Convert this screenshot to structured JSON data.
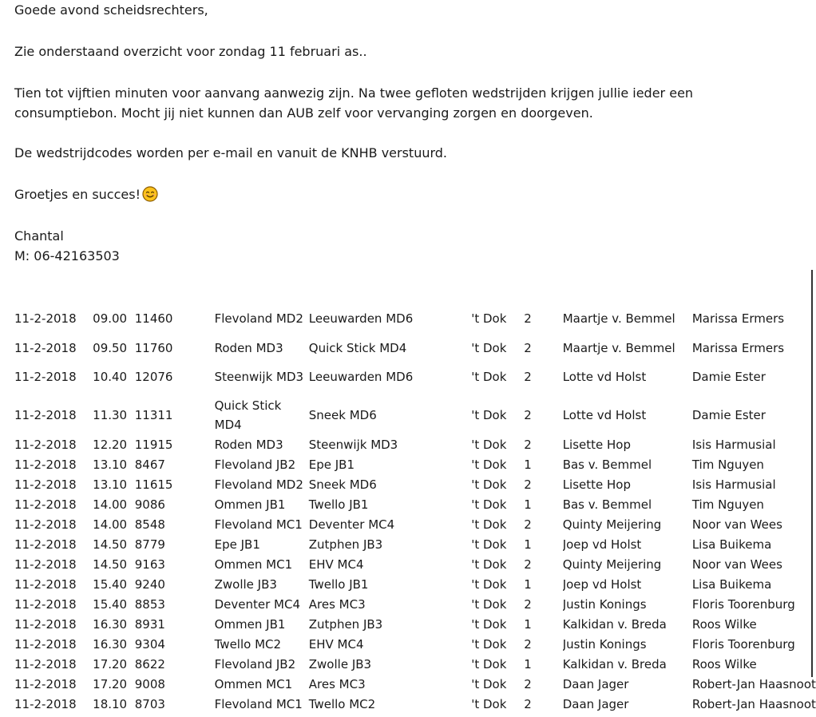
{
  "letter": {
    "greeting": "Goede avond scheidsrechters,",
    "intro": "Zie onderstaand overzicht voor zondag 11 februari as..",
    "instruction_1": "Tien tot vijftien minuten voor aanvang aanwezig zijn. Na twee gefloten wedstrijden krijgen jullie ieder een",
    "instruction_2": "consumptiebon. Mocht jij niet kunnen dan AUB zelf voor vervanging zorgen en doorgeven.",
    "codes_note": "De wedstrijdcodes worden per e-mail en vanuit de KNHB verstuurd.",
    "closing": "Groetjes en succes!",
    "closing_icon": "smiling-face-icon",
    "signature_name": "Chantal",
    "signature_phone": "M: 06-42163503"
  },
  "colors": {
    "text": "#1a1a1a",
    "emoji_face": "#fcc21b",
    "emoji_outline": "#8a5a00"
  },
  "schedule": [
    {
      "date": "11-2-2018",
      "time": "09.00",
      "code": "11460",
      "home": "Flevoland MD2",
      "away": "Leeuwarden MD6",
      "location": "'t Dok",
      "field": "2",
      "ref1": "Maartje v. Bemmel",
      "ref2": "Marissa Ermers"
    },
    {
      "date": "11-2-2018",
      "time": "09.50",
      "code": "11760",
      "home": "Roden MD3",
      "away": "Quick Stick MD4",
      "location": "'t Dok",
      "field": "2",
      "ref1": "Maartje v. Bemmel",
      "ref2": "Marissa Ermers"
    },
    {
      "date": "11-2-2018",
      "time": "10.40",
      "code": "12076",
      "home": "Steenwijk MD3",
      "away": "Leeuwarden MD6",
      "location": "'t Dok",
      "field": "2",
      "ref1": "Lotte vd Holst",
      "ref2": "Damie Ester"
    },
    {
      "date": "11-2-2018",
      "time": "11.30",
      "code": "11311",
      "home": "Quick Stick MD4",
      "away": "Sneek MD6",
      "location": "'t Dok",
      "field": "2",
      "ref1": "Lotte vd Holst",
      "ref2": "Damie Ester"
    },
    {
      "date": "11-2-2018",
      "time": "12.20",
      "code": "11915",
      "home": "Roden MD3",
      "away": "Steenwijk MD3",
      "location": "'t Dok",
      "field": "2",
      "ref1": "Lisette Hop",
      "ref2": "Isis Harmusial"
    },
    {
      "date": "11-2-2018",
      "time": "13.10",
      "code": "8467",
      "home": "Flevoland JB2",
      "away": "Epe JB1",
      "location": "'t Dok",
      "field": "1",
      "ref1": "Bas v. Bemmel",
      "ref2": "Tim Nguyen"
    },
    {
      "date": "11-2-2018",
      "time": "13.10",
      "code": "11615",
      "home": "Flevoland MD2",
      "away": "Sneek MD6",
      "location": "'t Dok",
      "field": "2",
      "ref1": "Lisette Hop",
      "ref2": "Isis Harmusial"
    },
    {
      "date": "11-2-2018",
      "time": "14.00",
      "code": "9086",
      "home": "Ommen JB1",
      "away": "Twello JB1",
      "location": "'t Dok",
      "field": "1",
      "ref1": "Bas v. Bemmel",
      "ref2": "Tim Nguyen"
    },
    {
      "date": "11-2-2018",
      "time": "14.00",
      "code": "8548",
      "home": "Flevoland MC1",
      "away": "Deventer MC4",
      "location": "'t Dok",
      "field": "2",
      "ref1": "Quinty Meijering",
      "ref2": "Noor van Wees"
    },
    {
      "date": "11-2-2018",
      "time": "14.50",
      "code": "8779",
      "home": "Epe JB1",
      "away": "Zutphen JB3",
      "location": "'t Dok",
      "field": "1",
      "ref1": "Joep vd Holst",
      "ref2": "Lisa Buikema"
    },
    {
      "date": "11-2-2018",
      "time": "14.50",
      "code": "9163",
      "home": "Ommen MC1",
      "away": "EHV MC4",
      "location": "'t Dok",
      "field": "2",
      "ref1": "Quinty Meijering",
      "ref2": "Noor van Wees"
    },
    {
      "date": "11-2-2018",
      "time": "15.40",
      "code": "9240",
      "home": "Zwolle JB3",
      "away": "Twello JB1",
      "location": "'t Dok",
      "field": "1",
      "ref1": "Joep vd Holst",
      "ref2": "Lisa Buikema"
    },
    {
      "date": "11-2-2018",
      "time": "15.40",
      "code": "8853",
      "home": "Deventer MC4",
      "away": "Ares MC3",
      "location": "'t Dok",
      "field": "2",
      "ref1": "Justin Konings",
      "ref2": "Floris Toorenburg"
    },
    {
      "date": "11-2-2018",
      "time": "16.30",
      "code": "8931",
      "home": "Ommen JB1",
      "away": "Zutphen JB3",
      "location": "'t Dok",
      "field": "1",
      "ref1": "Kalkidan v. Breda",
      "ref2": "Roos Wilke"
    },
    {
      "date": "11-2-2018",
      "time": "16.30",
      "code": "9304",
      "home": "Twello MC2",
      "away": "EHV MC4",
      "location": "'t Dok",
      "field": "2",
      "ref1": "Justin Konings",
      "ref2": "Floris Toorenburg"
    },
    {
      "date": "11-2-2018",
      "time": "17.20",
      "code": "8622",
      "home": "Flevoland JB2",
      "away": "Zwolle JB3",
      "location": "'t Dok",
      "field": "1",
      "ref1": "Kalkidan v. Breda",
      "ref2": "Roos Wilke"
    },
    {
      "date": "11-2-2018",
      "time": "17.20",
      "code": "9008",
      "home": "Ommen MC1",
      "away": "Ares MC3",
      "location": "'t Dok",
      "field": "2",
      "ref1": "Daan Jager",
      "ref2": "Robert-Jan Haasnoot"
    },
    {
      "date": "11-2-2018",
      "time": "18.10",
      "code": "8703",
      "home": "Flevoland MC1",
      "away": "Twello MC2",
      "location": "'t Dok",
      "field": "2",
      "ref1": "Daan Jager",
      "ref2": "Robert-Jan Haasnoot"
    }
  ]
}
